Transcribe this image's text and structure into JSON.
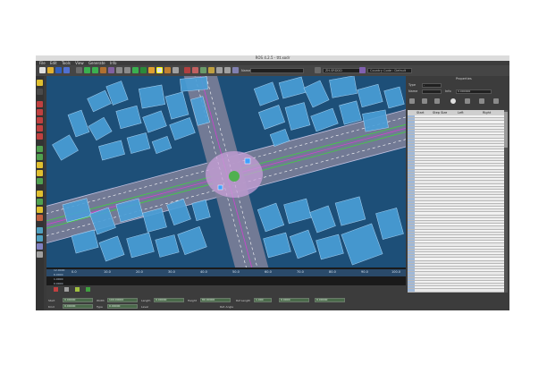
{
  "window": {
    "title": "ROS 4.2.5 - ttt.xodr"
  },
  "menu": {
    "items": [
      "File",
      "Edit",
      "Tools",
      "View",
      "Generate",
      "Info"
    ]
  },
  "toolbar": {
    "field1_value": "",
    "field2_value": "ZH.SRDDD",
    "dropdown_label": "Country Code : Default",
    "name_label": "Name:"
  },
  "timeline": {
    "ticks": [
      "0.0",
      "10.0",
      "20.0",
      "30.0",
      "40.0",
      "50.0",
      "60.0",
      "70.0",
      "80.0",
      "90.0",
      "100.0"
    ],
    "legend": [
      "12.0000",
      "6.0000",
      "1.0000",
      "0.0000"
    ]
  },
  "bottom": {
    "fields_row1": [
      "0.00000",
      "100.00000",
      "0.00000",
      "80.00000",
      "1.000"
    ],
    "fields_row2": [
      "0.00000",
      "0.00000",
      "0.0000",
      "0.00000"
    ],
    "labels": [
      "Start",
      "Width",
      "Length",
      "Height",
      "Kind",
      "Type",
      "Level",
      "Ref Length"
    ],
    "angle_label": "Ref. Angle"
  },
  "rightpanel": {
    "header": "Properties",
    "labels": [
      "Type",
      "Name",
      "Info"
    ],
    "fields": [
      "-",
      "",
      "0.000000"
    ],
    "columns": [
      "Start",
      "Step Size",
      "Left",
      "Right"
    ]
  },
  "colors": {
    "water": "#1d4f78",
    "building": "#4a9fd8",
    "road": "#8a8aa0",
    "intersection": "#c8a0d8"
  }
}
